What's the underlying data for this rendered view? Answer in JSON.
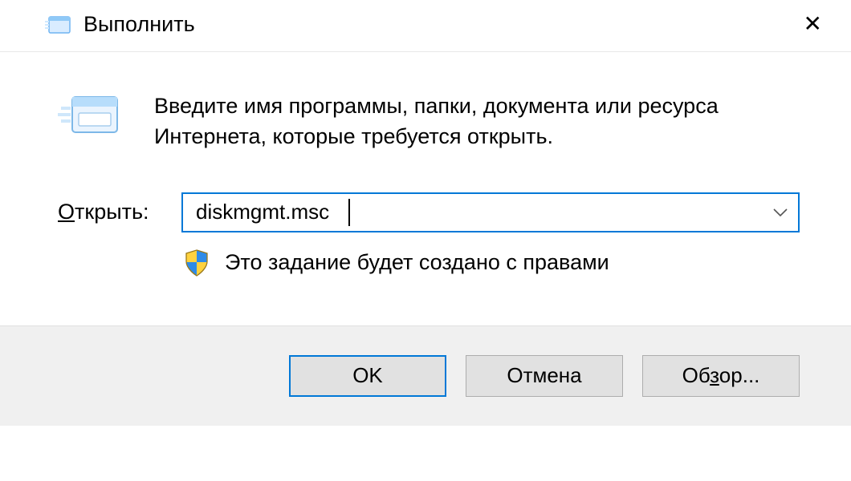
{
  "dialog": {
    "title": "Выполнить",
    "description": "Введите имя программы, папки, документа или ресурса Интернета, которые требуется открыть.",
    "open_label_pre": "О",
    "open_label_rest": "ткрыть:",
    "input_value": "diskmgmt.msc",
    "admin_text": "Это задание будет создано с правами",
    "buttons": {
      "ok": "OK",
      "cancel": "Отмена",
      "browse_pre": "Об",
      "browse_ul": "з",
      "browse_post": "ор..."
    }
  }
}
